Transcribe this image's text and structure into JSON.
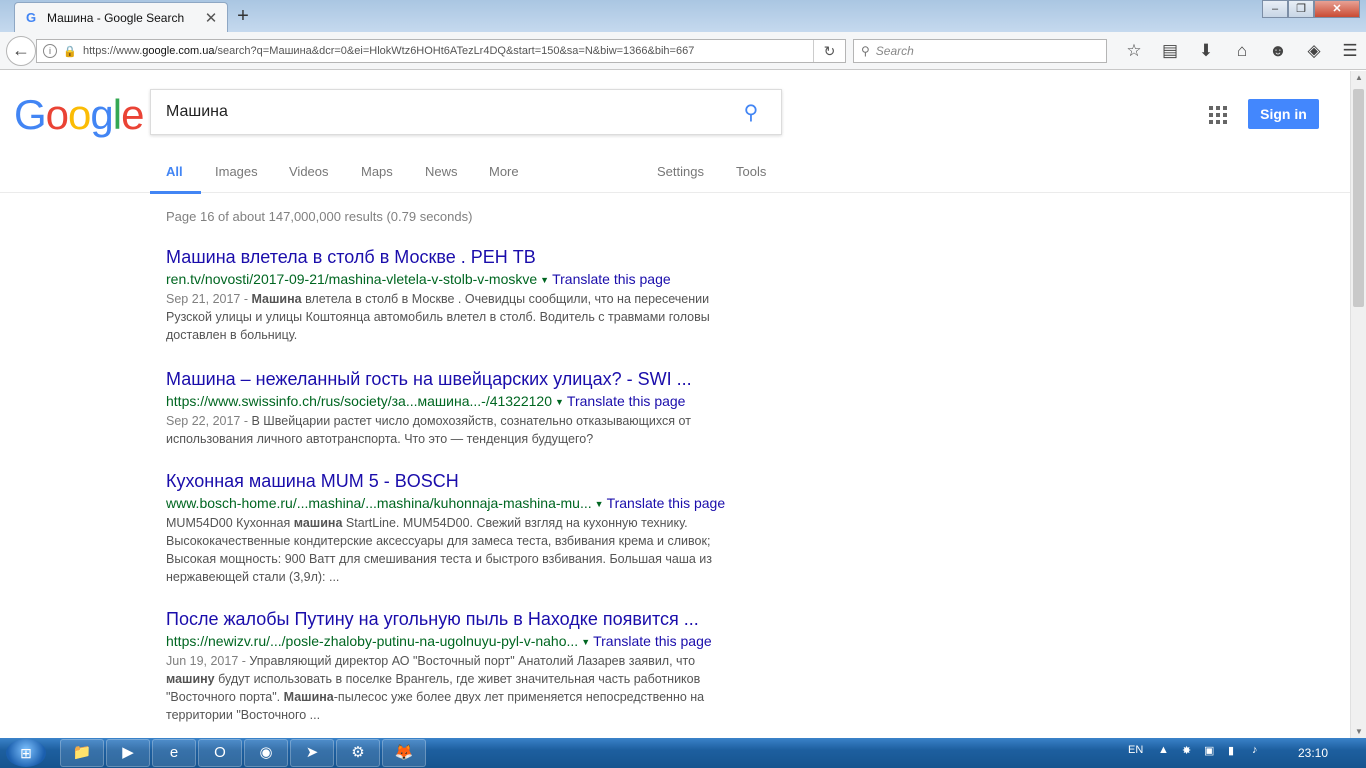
{
  "browser": {
    "tab_title": "Машина - Google Search",
    "tab_close": "✕",
    "new_tab": "+",
    "url_prefix": "https://www.",
    "url_host": "google.com.ua",
    "url_rest": "/search?q=Машина&dcr=0&ei=HlokWtz6HOHt6ATezLr4DQ&start=150&sa=N&biw=1366&bih=667",
    "search_placeholder": "Search",
    "toolbar_icons": [
      "star-icon",
      "reading-list-icon",
      "download-icon",
      "home-icon",
      "hello-icon",
      "pocket-icon",
      "menu-icon"
    ]
  },
  "google": {
    "logo_letters": [
      "G",
      "o",
      "o",
      "g",
      "l",
      "e"
    ],
    "query": "Машина",
    "signin_label": "Sign in",
    "tabs": [
      "All",
      "Images",
      "Videos",
      "Maps",
      "News",
      "More"
    ],
    "settings_label": "Settings",
    "tools_label": "Tools",
    "stats": "Page 16 of about 147,000,000 results (0.79 seconds)"
  },
  "results": [
    {
      "title": "Машина влетела в столб в Москве . РЕН ТВ",
      "url": "ren.tv/novosti/2017-09-21/mashina-vletela-v-stolb-v-moskve",
      "translate": "Translate this page",
      "date": "Sep 21, 2017 - ",
      "snippet_bold": "Машина",
      "snippet": " влетела в столб в Москве . Очевидцы сообщили, что на пересечении Рузской улицы и улицы Коштоянца автомобиль влетел в столб. Водитель с травмами головы доставлен в больницу."
    },
    {
      "title": "Машина – нежеланный гость на швейцарских улицах? - SWI ...",
      "url": "https://www.swissinfo.ch/rus/society/за...машина...-/41322120",
      "translate": "Translate this page",
      "date": "Sep 22, 2017 - ",
      "snippet_bold": "",
      "snippet": "В Швейцарии растет число домохозяйств, сознательно отказывающихся от использования личного автотранспорта. Что это — тенденция будущего?"
    },
    {
      "title": "Кухонная машина MUM 5 - BOSCH",
      "url": "www.bosch-home.ru/...mashina/...mashina/kuhonnaja-mashina-mu...",
      "translate": "Translate this page",
      "date": "",
      "pre": "MUM54D00 Кухонная ",
      "snippet_bold": "машина",
      "snippet": " StartLine. MUM54D00. Свежий взгляд на кухонную технику. Высококачественные кондитерские аксессуары для замеса теста, взбивания крема и сливок; Высокая мощность: 900 Ватт для смешивания теста и быстрого взбивания. Большая чаша из нержавеющей стали (3,9л): ..."
    },
    {
      "title": "После жалобы Путину на угольную пыль в Находке появится ...",
      "url": "https://newizv.ru/.../posle-zhaloby-putinu-na-ugolnuyu-pyl-v-naho...",
      "translate": "Translate this page",
      "date": "Jun 19, 2017 - ",
      "pre": "Управляющий директор АО \"Восточный порт\" Анатолий Лазарев заявил, что ",
      "snippet_bold": "машину",
      "snippet": " будут использовать в поселке Врангель, где живет значительная часть работников \"Восточного порта\". ",
      "snippet_bold2": "Машина",
      "snippet2": "-пылесос уже более двух лет применяется непосредственно на территории \"Восточного ..."
    }
  ],
  "taskbar": {
    "apps": [
      "explorer-icon",
      "media-player-icon",
      "ie-icon",
      "opera-icon",
      "chrome-icon",
      "telegram-icon",
      "settings-app-icon",
      "firefox-icon"
    ],
    "lang": "EN",
    "time": "23:10"
  }
}
